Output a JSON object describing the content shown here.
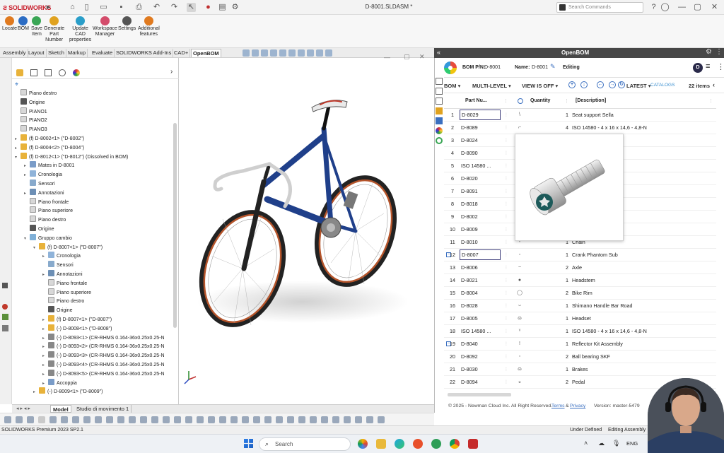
{
  "app": {
    "brand": "SOLIDWORKS",
    "document_title": "D-8001.SLDASM *",
    "search_placeholder": "Search Commands"
  },
  "command_manager": [
    {
      "label": "Locate",
      "color": "#e07a1f"
    },
    {
      "label": "BOM",
      "color": "#2b6cc4"
    },
    {
      "label": "Save\nItem",
      "color": "#3aa655"
    },
    {
      "label": "Generate\nPart\nNumber",
      "color": "#e0a21f"
    },
    {
      "label": "Update\nCAD\nproperties",
      "color": "#2a9ec9"
    },
    {
      "label": "Workspace\nManager",
      "color": "#d44c6b"
    },
    {
      "label": "Settings",
      "color": "#555555"
    },
    {
      "label": "Additional\nfeatures",
      "color": "#e07a1f"
    }
  ],
  "tabs": [
    "Assembly",
    "Layout",
    "Sketch",
    "Markup",
    "Evaluate",
    "SOLIDWORKS Add-Ins",
    "CAD+",
    "OpenBOM"
  ],
  "active_tab": "OpenBOM",
  "tree": [
    {
      "label": "Piano destro",
      "indent": 0,
      "icon": "plane-icon",
      "arrow": ""
    },
    {
      "label": "Origine",
      "indent": 0,
      "icon": "origin-icon",
      "arrow": ""
    },
    {
      "label": "PIANO1",
      "indent": 0,
      "icon": "plane-icon",
      "arrow": ""
    },
    {
      "label": "PIANO2",
      "indent": 0,
      "icon": "plane-icon",
      "arrow": ""
    },
    {
      "label": "PIANO3",
      "indent": 0,
      "icon": "plane-icon",
      "arrow": ""
    },
    {
      "label": "(f) D-8002<1> (\"D-8002\")",
      "indent": 0,
      "icon": "subassembly-icon",
      "arrow": "▸"
    },
    {
      "label": "(f) D-8004<2> (\"D-8004\")",
      "indent": 0,
      "icon": "subassembly-icon",
      "arrow": "▸"
    },
    {
      "label": "(f) D-8012<1> (\"D-8012\") (Dissolved in BOM)",
      "indent": 0,
      "icon": "subassembly-icon",
      "arrow": "▾"
    },
    {
      "label": "Mates in D-8001",
      "indent": 1,
      "icon": "mates-icon",
      "arrow": "▸"
    },
    {
      "label": "Cronologia",
      "indent": 1,
      "icon": "history-icon",
      "arrow": "▸"
    },
    {
      "label": "Sensori",
      "indent": 1,
      "icon": "sensor-icon",
      "arrow": ""
    },
    {
      "label": "Annotazioni",
      "indent": 1,
      "icon": "annotation-icon",
      "arrow": "▸"
    },
    {
      "label": "Piano frontale",
      "indent": 1,
      "icon": "plane-icon",
      "arrow": ""
    },
    {
      "label": "Piano superiore",
      "indent": 1,
      "icon": "plane-icon",
      "arrow": ""
    },
    {
      "label": "Piano destro",
      "indent": 1,
      "icon": "plane-icon",
      "arrow": ""
    },
    {
      "label": "Origine",
      "indent": 1,
      "icon": "origin-icon",
      "arrow": ""
    },
    {
      "label": "Gruppo cambio",
      "indent": 1,
      "icon": "folder-icon",
      "arrow": "▾"
    },
    {
      "label": "(f) D-8007<1> (\"D-8007\")",
      "indent": 2,
      "icon": "subassembly-icon",
      "arrow": "▾"
    },
    {
      "label": "Cronologia",
      "indent": 3,
      "icon": "history-icon",
      "arrow": "▸"
    },
    {
      "label": "Sensori",
      "indent": 3,
      "icon": "sensor-icon",
      "arrow": ""
    },
    {
      "label": "Annotazioni",
      "indent": 3,
      "icon": "annotation-icon",
      "arrow": "▸"
    },
    {
      "label": "Piano frontale",
      "indent": 3,
      "icon": "plane-icon",
      "arrow": ""
    },
    {
      "label": "Piano superiore",
      "indent": 3,
      "icon": "plane-icon",
      "arrow": ""
    },
    {
      "label": "Piano destro",
      "indent": 3,
      "icon": "plane-icon",
      "arrow": ""
    },
    {
      "label": "Origine",
      "indent": 3,
      "icon": "origin-icon",
      "arrow": ""
    },
    {
      "label": "(f) D-8007<1> (\"D-8007\")",
      "indent": 3,
      "icon": "subassembly-icon",
      "arrow": "▸"
    },
    {
      "label": "(-) D-8008<1> (\"D-8008\")",
      "indent": 3,
      "icon": "subassembly-icon",
      "arrow": "▸"
    },
    {
      "label": "(-) D-8093<1> (CR-RHMS 0.164-36x0.25x0.25-N",
      "indent": 3,
      "icon": "bolt-icon",
      "arrow": "▸"
    },
    {
      "label": "(-) D-8093<2> (CR-RHMS 0.164-36x0.25x0.25-N",
      "indent": 3,
      "icon": "bolt-icon",
      "arrow": "▸"
    },
    {
      "label": "(-) D-8093<3> (CR-RHMS 0.164-36x0.25x0.25-N",
      "indent": 3,
      "icon": "bolt-icon",
      "arrow": "▸"
    },
    {
      "label": "(-) D-8093<4> (CR-RHMS 0.164-36x0.25x0.25-N",
      "indent": 3,
      "icon": "bolt-icon",
      "arrow": "▸"
    },
    {
      "label": "(-) D-8093<5> (CR-RHMS 0.164-36x0.25x0.25-N",
      "indent": 3,
      "icon": "bolt-icon",
      "arrow": "▸"
    },
    {
      "label": "Accoppia",
      "indent": 3,
      "icon": "mates-icon",
      "arrow": "▸"
    },
    {
      "label": "(-) D-8009<1> (\"D-8009\")",
      "indent": 2,
      "icon": "subassembly-icon",
      "arrow": "▸"
    }
  ],
  "bottom_tabs": [
    "Model",
    "Studio di movimento 1"
  ],
  "status_bar": {
    "left": "SOLIDWORKS Premium 2023 SP2.1",
    "mid": "Under Defined",
    "right": "Editing Assembly"
  },
  "openbom": {
    "panel_title": "OpenBOM",
    "bom_pn_label": "BOM P/N:",
    "bom_pn_value": "D-8001",
    "name_label": "Name:",
    "name_value": "D-8001",
    "mode": "Editing",
    "avatar": "D",
    "toolbar": {
      "bom": "BOM ▾",
      "multilevel": "MULTI-LEVEL ▾",
      "view": "VIEW IS OFF ▾",
      "latest": "LATEST ▾",
      "catalogs": "CATALOGS",
      "items": "22 items"
    },
    "columns": {
      "part": "Part Nu...",
      "qty": "Quantity",
      "desc": "[Description]"
    },
    "rows": [
      {
        "idx": "1",
        "pn": "D-8029",
        "qty": "1",
        "desc": "Seat support Sella",
        "box": true,
        "exp": ""
      },
      {
        "idx": "2",
        "pn": "D-8089",
        "qty": "4",
        "desc": "ISO 14580 - 4 x 16 x 14,6 - 4,8-N",
        "box": false,
        "exp": ""
      },
      {
        "idx": "3",
        "pn": "D-8024",
        "qty": "",
        "desc": "",
        "box": false,
        "exp": ""
      },
      {
        "idx": "4",
        "pn": "D-8090",
        "qty": "",
        "desc": "e I Cross",
        "box": false,
        "exp": ""
      },
      {
        "idx": "5",
        "pn": "ISO 14580 ...",
        "qty": "",
        "desc": "8-N",
        "box": false,
        "exp": ""
      },
      {
        "idx": "6",
        "pn": "D-8020",
        "qty": "",
        "desc": "",
        "box": false,
        "exp": ""
      },
      {
        "idx": "7",
        "pn": "D-8091",
        "qty": "",
        "desc": "",
        "box": false,
        "exp": ""
      },
      {
        "idx": "8",
        "pn": "D-8018",
        "qty": "",
        "desc": "",
        "box": false,
        "exp": ""
      },
      {
        "idx": "9",
        "pn": "D-8002",
        "qty": "",
        "desc": "",
        "box": false,
        "exp": ""
      },
      {
        "idx": "10",
        "pn": "D-8009",
        "qty": "",
        "desc": "",
        "box": false,
        "exp": ""
      },
      {
        "idx": "11",
        "pn": "D-8010",
        "qty": "1",
        "desc": "Chain",
        "box": false,
        "exp": ""
      },
      {
        "idx": "12",
        "pn": "D-8007",
        "qty": "1",
        "desc": "Crank Phantom Sub",
        "box": true,
        "exp": "−"
      },
      {
        "idx": "13",
        "pn": "D-8006",
        "qty": "2",
        "desc": "Axle",
        "box": false,
        "exp": ""
      },
      {
        "idx": "14",
        "pn": "D-8021",
        "qty": "1",
        "desc": "Headstem",
        "box": false,
        "exp": ""
      },
      {
        "idx": "15",
        "pn": "D-8004",
        "qty": "2",
        "desc": "Bike Rim",
        "box": false,
        "exp": ""
      },
      {
        "idx": "16",
        "pn": "D-8028",
        "qty": "1",
        "desc": "Shimano Handle Bar Road",
        "box": false,
        "exp": ""
      },
      {
        "idx": "17",
        "pn": "D-8005",
        "qty": "1",
        "desc": "Headset",
        "box": false,
        "exp": ""
      },
      {
        "idx": "18",
        "pn": "ISO 14580 ...",
        "qty": "1",
        "desc": "ISO 14580 - 4 x 16 x 14,6 - 4,8-N",
        "box": false,
        "exp": ""
      },
      {
        "idx": "19",
        "pn": "D-8040",
        "qty": "1",
        "desc": "Reflector Kit Assembly",
        "box": false,
        "exp": "−"
      },
      {
        "idx": "20",
        "pn": "D-8092",
        "qty": "2",
        "desc": "Ball bearing SKF",
        "box": false,
        "exp": ""
      },
      {
        "idx": "21",
        "pn": "D-8030",
        "qty": "1",
        "desc": "Brakes",
        "box": false,
        "exp": ""
      },
      {
        "idx": "22",
        "pn": "D-8094",
        "qty": "2",
        "desc": "Pedal",
        "box": false,
        "exp": ""
      }
    ],
    "footer": {
      "copyright": "© 2025 - Newman Cloud Inc. All Right Reserved.",
      "terms": "Terms",
      "amp": "&",
      "privacy": "Privacy",
      "version": "Version: master-5479"
    }
  },
  "taskbar": {
    "search_placeholder": "Search",
    "lang": "ENG"
  },
  "colors": {
    "accent": "#3a6fc0",
    "openbom_header": "#474747",
    "bike_frame": "#1f3f8a",
    "tire": "#b5542a"
  }
}
